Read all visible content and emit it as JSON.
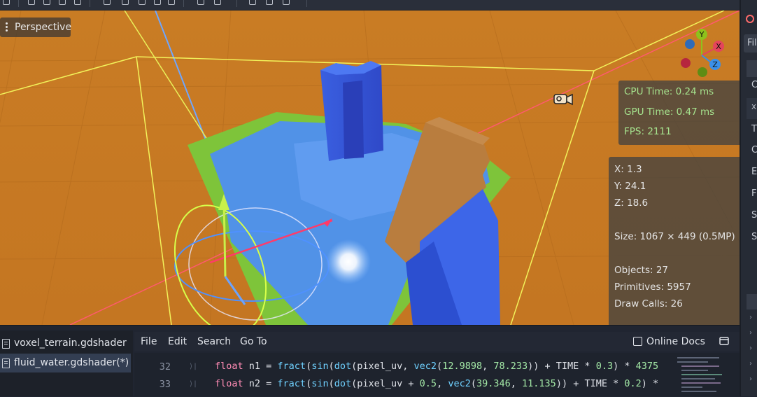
{
  "viewport": {
    "view_mode": "Perspective",
    "gizmo": {
      "y_label": "Y",
      "x_label": "X",
      "z_label": "Z"
    },
    "performance": {
      "cpu_time": "CPU Time: 0.24 ms",
      "gpu_time": "GPU Time: 0.47 ms",
      "fps": "FPS: 2111"
    },
    "info": {
      "x": "X: 1.3",
      "y": "Y: 24.1",
      "z": "Z: 18.6",
      "size": "Size: 1067 × 449 (0.5MP)",
      "objects": "Objects: 27",
      "primitives": "Primitives: 5957",
      "draw_calls": "Draw Calls: 26"
    }
  },
  "right_panel": {
    "filter_text": "Fil",
    "letters": [
      "C",
      "X",
      "T",
      "C",
      "E",
      "F",
      "S",
      "S"
    ]
  },
  "script_editor": {
    "files": [
      {
        "name": "voxel_terrain.gdshader",
        "selected": false
      },
      {
        "name": "fluid_water.gdshader(*)",
        "selected": true
      }
    ],
    "menu": {
      "file": "File",
      "edit": "Edit",
      "search": "Search",
      "go_to": "Go To"
    },
    "online_docs": "Online Docs",
    "code_lines": [
      {
        "number": "32",
        "text": "float n1 = fract(sin(dot(pixel_uv, vec2(12.9898, 78.233)) + TIME * 0.3) * 4375"
      },
      {
        "number": "33",
        "text": "float n2 = fract(sin(dot(pixel_uv + 0.5, vec2(39.346, 11.135)) + TIME * 0.2) *"
      }
    ]
  },
  "colors": {
    "sky": "#c97c24",
    "water": "#4f8ff0",
    "grass": "#7ec43a",
    "dirt": "#b97d3e",
    "selection_box": "#f2f25a",
    "perf_text": "#a6e38e",
    "gizmo_x": "#e4445c",
    "gizmo_y": "#8ec21c",
    "gizmo_z": "#3b90e8"
  }
}
